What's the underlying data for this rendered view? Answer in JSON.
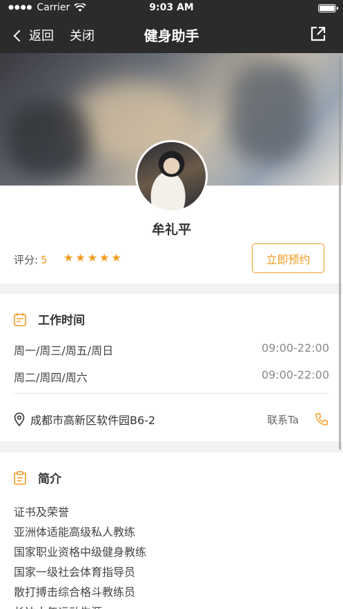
{
  "status_bar": {
    "carrier": "Carrier",
    "time": "9:03 AM"
  },
  "nav": {
    "back_label": "返回",
    "close_label": "关闭",
    "title": "健身助手"
  },
  "profile": {
    "name": "牟礼平",
    "rating_label": "评分:",
    "rating_value": "5",
    "stars": "★★★★★",
    "book_label": "立即预约"
  },
  "work": {
    "title": "工作时间",
    "schedule": [
      {
        "days": "周一/周三/周五/周日",
        "time": "09:00-22:00"
      },
      {
        "days": "周二/周四/周六",
        "time": "09:00-22:00"
      }
    ],
    "address": "成都市高新区软件园B6-2",
    "contact_label": "联系Ta"
  },
  "intro": {
    "title": "简介",
    "lines": [
      "证书及荣誉",
      "亚洲体适能高级私人教练",
      "国家职业资格中级健身教练",
      "国家一级社会体育指导员",
      "散打搏击综合格斗教练员",
      "长达十年运动生涯"
    ]
  },
  "colors": {
    "accent": "#f29b1f",
    "nav_bg": "#2b2b2b"
  }
}
